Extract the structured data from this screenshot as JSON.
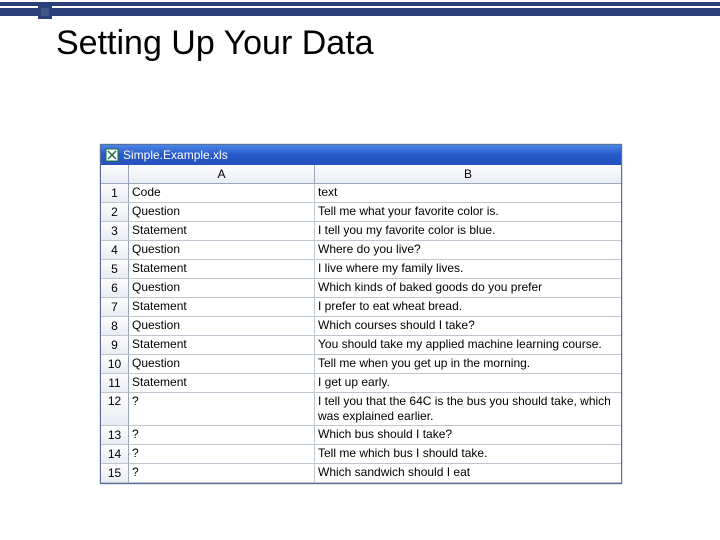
{
  "slide": {
    "title": "Setting Up Your Data"
  },
  "window": {
    "filename": "Simple.Example.xls"
  },
  "columns": {
    "A": "A",
    "B": "B"
  },
  "rows": [
    {
      "n": "1",
      "A": "Code",
      "B": "text"
    },
    {
      "n": "2",
      "A": "Question",
      "B": "Tell me what your favorite color is."
    },
    {
      "n": "3",
      "A": "Statement",
      "B": "I tell you my favorite color is blue."
    },
    {
      "n": "4",
      "A": "Question",
      "B": "Where do you live?"
    },
    {
      "n": "5",
      "A": "Statement",
      "B": "I live where my family lives."
    },
    {
      "n": "6",
      "A": "Question",
      "B": "Which kinds of baked goods do you prefer"
    },
    {
      "n": "7",
      "A": "Statement",
      "B": "I prefer to eat wheat bread."
    },
    {
      "n": "8",
      "A": "Question",
      "B": "Which courses should I take?"
    },
    {
      "n": "9",
      "A": "Statement",
      "B": "You should take my applied machine learning course."
    },
    {
      "n": "10",
      "A": "Question",
      "B": "Tell me when you get up in the morning."
    },
    {
      "n": "11",
      "A": "Statement",
      "B": "I get up early."
    },
    {
      "n": "12",
      "A": "?",
      "B": "I tell you that the 64C is the bus you should take, which was explained earlier."
    },
    {
      "n": "13",
      "A": "?",
      "B": "Which bus should I take?"
    },
    {
      "n": "14",
      "A": "?",
      "B": "Tell me which bus I should take."
    },
    {
      "n": "15",
      "A": "?",
      "B": "Which sandwich should I eat"
    }
  ]
}
